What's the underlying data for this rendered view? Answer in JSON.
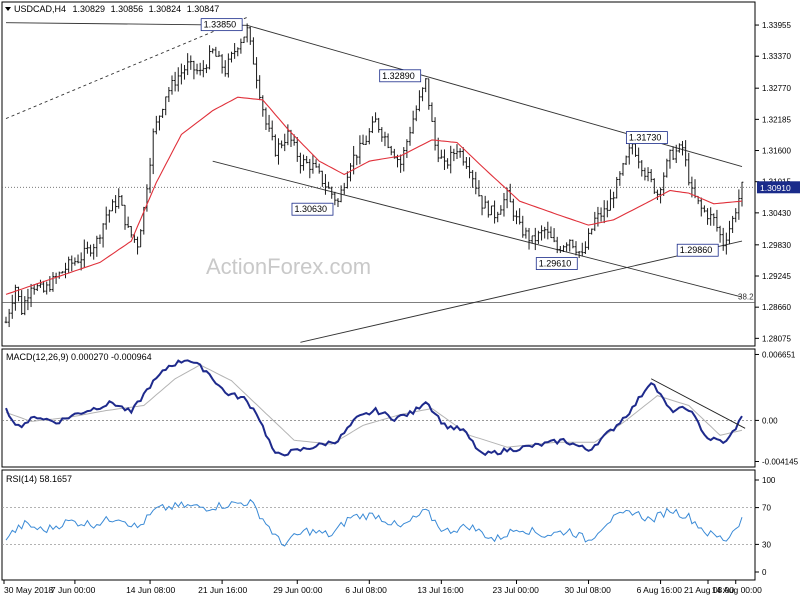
{
  "header": {
    "symbol": "USDCAD,H4",
    "open": "1.30829",
    "high": "1.30856",
    "low": "1.30824",
    "close": "1.30847"
  },
  "watermark": "ActionForex.com",
  "colors": {
    "bars": "#1a1a1a",
    "ma": "#e0303a",
    "macd": "#1e2a8c",
    "signal": "#b3b3b3",
    "rsi": "#3a8ad6",
    "trendline": "#333333",
    "price_label_bg": "#1a2b8a"
  },
  "chart_data": [
    {
      "type": "line",
      "subtype": "ohlc-bars",
      "title": "USDCAD,H4 1.30829 1.30856 1.30824 1.30847",
      "ylim": [
        1.2795,
        1.3435
      ],
      "y_ticks": [
        "1.33955",
        "1.33370",
        "1.32770",
        "1.32185",
        "1.31600",
        "1.31015",
        "1.30430",
        "1.29830",
        "1.29245",
        "1.28660",
        "1.28075"
      ],
      "current_price": "1.30910",
      "fib_level": {
        "label": "38.2",
        "value": 1.2875
      },
      "x_tick_labels": [
        "30 May 2018",
        "7 Jun 00:00",
        "14 Jun 08:00",
        "21 Jun 16:00",
        "29 Jun 00:00",
        "6 Jul 08:00",
        "13 Jul 16:00",
        "23 Jul 00:00",
        "30 Jul 08:00",
        "6 Aug 16:00",
        "14 Aug 00:00",
        "21 Aug 08:00"
      ],
      "annotations": [
        {
          "text": "1.33850",
          "price": 1.3385
        },
        {
          "text": "1.32890",
          "price": 1.3289
        },
        {
          "text": "1.30630",
          "price": 1.3063
        },
        {
          "text": "1.29610",
          "price": 1.2961
        },
        {
          "text": "1.31730",
          "price": 1.3173
        },
        {
          "text": "1.29860",
          "price": 1.2986
        }
      ],
      "price_path": [
        {
          "i": 0,
          "p": 1.2838
        },
        {
          "i": 3,
          "p": 1.2905
        },
        {
          "i": 5,
          "p": 1.286
        },
        {
          "i": 8,
          "p": 1.291
        },
        {
          "i": 12,
          "p": 1.2895
        },
        {
          "i": 15,
          "p": 1.2915
        },
        {
          "i": 20,
          "p": 1.2945
        },
        {
          "i": 24,
          "p": 1.296
        },
        {
          "i": 29,
          "p": 1.299
        },
        {
          "i": 32,
          "p": 1.304
        },
        {
          "i": 36,
          "p": 1.307
        },
        {
          "i": 39,
          "p": 1.301
        },
        {
          "i": 42,
          "p": 1.2985
        },
        {
          "i": 44,
          "p": 1.305
        },
        {
          "i": 47,
          "p": 1.319
        },
        {
          "i": 51,
          "p": 1.3265
        },
        {
          "i": 55,
          "p": 1.33
        },
        {
          "i": 58,
          "p": 1.332
        },
        {
          "i": 62,
          "p": 1.3305
        },
        {
          "i": 66,
          "p": 1.3345
        },
        {
          "i": 70,
          "p": 1.331
        },
        {
          "i": 74,
          "p": 1.336
        },
        {
          "i": 77,
          "p": 1.3385
        },
        {
          "i": 80,
          "p": 1.33
        },
        {
          "i": 83,
          "p": 1.321
        },
        {
          "i": 86,
          "p": 1.316
        },
        {
          "i": 90,
          "p": 1.319
        },
        {
          "i": 94,
          "p": 1.314
        },
        {
          "i": 98,
          "p": 1.313
        },
        {
          "i": 102,
          "p": 1.3095
        },
        {
          "i": 106,
          "p": 1.3063
        },
        {
          "i": 110,
          "p": 1.314
        },
        {
          "i": 114,
          "p": 1.317
        },
        {
          "i": 118,
          "p": 1.3215
        },
        {
          "i": 122,
          "p": 1.3175
        },
        {
          "i": 126,
          "p": 1.3135
        },
        {
          "i": 130,
          "p": 1.322
        },
        {
          "i": 134,
          "p": 1.3289
        },
        {
          "i": 137,
          "p": 1.317
        },
        {
          "i": 140,
          "p": 1.313
        },
        {
          "i": 144,
          "p": 1.3165
        },
        {
          "i": 148,
          "p": 1.313
        },
        {
          "i": 152,
          "p": 1.306
        },
        {
          "i": 156,
          "p": 1.304
        },
        {
          "i": 160,
          "p": 1.3075
        },
        {
          "i": 164,
          "p": 1.3015
        },
        {
          "i": 168,
          "p": 1.299
        },
        {
          "i": 172,
          "p": 1.301
        },
        {
          "i": 176,
          "p": 1.2975
        },
        {
          "i": 180,
          "p": 1.2995
        },
        {
          "i": 184,
          "p": 1.2961
        },
        {
          "i": 188,
          "p": 1.303
        },
        {
          "i": 192,
          "p": 1.305
        },
        {
          "i": 196,
          "p": 1.311
        },
        {
          "i": 200,
          "p": 1.3173
        },
        {
          "i": 204,
          "p": 1.312
        },
        {
          "i": 208,
          "p": 1.308
        },
        {
          "i": 212,
          "p": 1.315
        },
        {
          "i": 216,
          "p": 1.3165
        },
        {
          "i": 219,
          "p": 1.308
        },
        {
          "i": 222,
          "p": 1.305
        },
        {
          "i": 226,
          "p": 1.303
        },
        {
          "i": 229,
          "p": 1.2986
        },
        {
          "i": 232,
          "p": 1.303
        },
        {
          "i": 235,
          "p": 1.3091
        }
      ],
      "ma_path": [
        {
          "i": 0,
          "p": 1.289
        },
        {
          "i": 20,
          "p": 1.293
        },
        {
          "i": 30,
          "p": 1.295
        },
        {
          "i": 40,
          "p": 1.299
        },
        {
          "i": 48,
          "p": 1.31
        },
        {
          "i": 56,
          "p": 1.319
        },
        {
          "i": 66,
          "p": 1.3235
        },
        {
          "i": 74,
          "p": 1.326
        },
        {
          "i": 82,
          "p": 1.3255
        },
        {
          "i": 90,
          "p": 1.32
        },
        {
          "i": 100,
          "p": 1.314
        },
        {
          "i": 108,
          "p": 1.3115
        },
        {
          "i": 116,
          "p": 1.314
        },
        {
          "i": 126,
          "p": 1.315
        },
        {
          "i": 136,
          "p": 1.318
        },
        {
          "i": 144,
          "p": 1.3175
        },
        {
          "i": 152,
          "p": 1.313
        },
        {
          "i": 164,
          "p": 1.3065
        },
        {
          "i": 176,
          "p": 1.304
        },
        {
          "i": 186,
          "p": 1.302
        },
        {
          "i": 194,
          "p": 1.303
        },
        {
          "i": 204,
          "p": 1.306
        },
        {
          "i": 212,
          "p": 1.3085
        },
        {
          "i": 218,
          "p": 1.308
        },
        {
          "i": 226,
          "p": 1.306
        },
        {
          "i": 235,
          "p": 1.3065
        }
      ]
    },
    {
      "type": "line",
      "title": "MACD(12,26,9) 0.000270 -0.000964",
      "ylim": [
        -0.0046,
        0.0069
      ],
      "y_ticks": [
        "0.006651",
        "0.00",
        "-0.004145"
      ],
      "series": [
        {
          "name": "MACD",
          "points": [
            {
              "i": 0,
              "v": 0.001
            },
            {
              "i": 4,
              "v": -0.0006
            },
            {
              "i": 10,
              "v": 0.0004
            },
            {
              "i": 16,
              "v": -0.0002
            },
            {
              "i": 22,
              "v": 0.0006
            },
            {
              "i": 28,
              "v": 0.0012
            },
            {
              "i": 34,
              "v": 0.0018
            },
            {
              "i": 40,
              "v": 0.0008
            },
            {
              "i": 46,
              "v": 0.0035
            },
            {
              "i": 52,
              "v": 0.0055
            },
            {
              "i": 58,
              "v": 0.0062
            },
            {
              "i": 64,
              "v": 0.005
            },
            {
              "i": 70,
              "v": 0.0028
            },
            {
              "i": 76,
              "v": 0.0022
            },
            {
              "i": 80,
              "v": 0.0008
            },
            {
              "i": 86,
              "v": -0.0035
            },
            {
              "i": 94,
              "v": -0.003
            },
            {
              "i": 100,
              "v": -0.0025
            },
            {
              "i": 106,
              "v": -0.002
            },
            {
              "i": 112,
              "v": 0.0002
            },
            {
              "i": 118,
              "v": 0.001
            },
            {
              "i": 124,
              "v": 0.0002
            },
            {
              "i": 130,
              "v": 0.0008
            },
            {
              "i": 134,
              "v": 0.002
            },
            {
              "i": 140,
              "v": -0.0005
            },
            {
              "i": 146,
              "v": -0.001
            },
            {
              "i": 152,
              "v": -0.0035
            },
            {
              "i": 160,
              "v": -0.003
            },
            {
              "i": 170,
              "v": -0.0025
            },
            {
              "i": 178,
              "v": -0.002
            },
            {
              "i": 186,
              "v": -0.003
            },
            {
              "i": 194,
              "v": -0.0008
            },
            {
              "i": 200,
              "v": 0.0012
            },
            {
              "i": 206,
              "v": 0.004
            },
            {
              "i": 212,
              "v": 0.001
            },
            {
              "i": 218,
              "v": 0.0012
            },
            {
              "i": 224,
              "v": -0.0018
            },
            {
              "i": 230,
              "v": -0.0022
            },
            {
              "i": 235,
              "v": 0.0003
            }
          ]
        },
        {
          "name": "Signal",
          "points": [
            {
              "i": 0,
              "v": 0.0008
            },
            {
              "i": 8,
              "v": -0.0001
            },
            {
              "i": 20,
              "v": 0.0003
            },
            {
              "i": 32,
              "v": 0.001
            },
            {
              "i": 44,
              "v": 0.0015
            },
            {
              "i": 54,
              "v": 0.0042
            },
            {
              "i": 62,
              "v": 0.0056
            },
            {
              "i": 72,
              "v": 0.004
            },
            {
              "i": 82,
              "v": 0.001
            },
            {
              "i": 92,
              "v": -0.002
            },
            {
              "i": 104,
              "v": -0.0024
            },
            {
              "i": 114,
              "v": -0.0005
            },
            {
              "i": 126,
              "v": 0.0006
            },
            {
              "i": 136,
              "v": 0.0012
            },
            {
              "i": 148,
              "v": -0.0015
            },
            {
              "i": 160,
              "v": -0.0027
            },
            {
              "i": 176,
              "v": -0.0022
            },
            {
              "i": 188,
              "v": -0.0022
            },
            {
              "i": 198,
              "v": 0.0
            },
            {
              "i": 208,
              "v": 0.0025
            },
            {
              "i": 218,
              "v": 0.0015
            },
            {
              "i": 228,
              "v": -0.0015
            },
            {
              "i": 235,
              "v": -0.001
            }
          ]
        }
      ]
    },
    {
      "type": "line",
      "title": "RSI(14) 58.1657",
      "ylim": [
        0,
        100
      ],
      "y_ticks": [
        "100",
        "70",
        "30",
        "0"
      ],
      "series": [
        {
          "name": "RSI",
          "points": [
            {
              "i": 0,
              "v": 38
            },
            {
              "i": 6,
              "v": 52
            },
            {
              "i": 12,
              "v": 45
            },
            {
              "i": 20,
              "v": 55
            },
            {
              "i": 28,
              "v": 52
            },
            {
              "i": 36,
              "v": 60
            },
            {
              "i": 42,
              "v": 48
            },
            {
              "i": 48,
              "v": 68
            },
            {
              "i": 56,
              "v": 72
            },
            {
              "i": 64,
              "v": 70
            },
            {
              "i": 72,
              "v": 74
            },
            {
              "i": 78,
              "v": 76
            },
            {
              "i": 82,
              "v": 58
            },
            {
              "i": 88,
              "v": 30
            },
            {
              "i": 96,
              "v": 45
            },
            {
              "i": 104,
              "v": 40
            },
            {
              "i": 110,
              "v": 60
            },
            {
              "i": 118,
              "v": 62
            },
            {
              "i": 126,
              "v": 48
            },
            {
              "i": 134,
              "v": 66
            },
            {
              "i": 140,
              "v": 44
            },
            {
              "i": 148,
              "v": 50
            },
            {
              "i": 156,
              "v": 35
            },
            {
              "i": 164,
              "v": 48
            },
            {
              "i": 172,
              "v": 40
            },
            {
              "i": 180,
              "v": 45
            },
            {
              "i": 186,
              "v": 34
            },
            {
              "i": 192,
              "v": 55
            },
            {
              "i": 200,
              "v": 66
            },
            {
              "i": 206,
              "v": 56
            },
            {
              "i": 212,
              "v": 68
            },
            {
              "i": 218,
              "v": 60
            },
            {
              "i": 224,
              "v": 42
            },
            {
              "i": 230,
              "v": 35
            },
            {
              "i": 235,
              "v": 58
            }
          ]
        }
      ]
    }
  ]
}
